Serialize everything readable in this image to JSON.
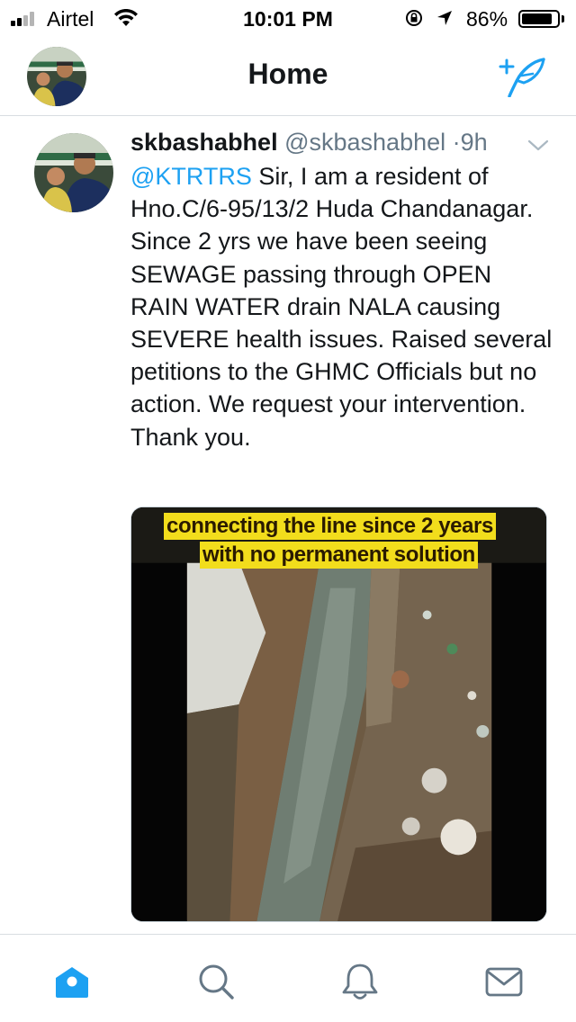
{
  "status_bar": {
    "carrier": "Airtel",
    "time": "10:01 PM",
    "battery_percent": "86%",
    "battery_level": 0.86,
    "signal_bars": 2
  },
  "nav": {
    "title": "Home",
    "compose_icon": "compose-tweet-icon"
  },
  "tweet": {
    "name": "skbashabhel",
    "handle": "@skbashabhel",
    "separator": "·",
    "time": "9h",
    "mention": "@KTRTRS",
    "body": " Sir, I am a resident of Hno.C/6-95/13/2 Huda Chandanagar. Since 2 yrs we have been seeing SEWAGE passing through OPEN RAIN WATER drain NALA causing SEVERE health issues. Raised several petitions to the GHMC Officials but no action. We request your intervention. Thank you.",
    "media": {
      "caption_line1": "connecting the line since 2 years",
      "caption_line2": "with no permanent solution"
    }
  },
  "tab_bar": {
    "items": [
      "home-icon",
      "search-icon",
      "notifications-icon",
      "messages-icon"
    ],
    "active": "home-icon"
  },
  "colors": {
    "accent": "#1da1f2",
    "text": "#14171a",
    "secondary": "#657786",
    "caption_bg": "#f2dd1c"
  }
}
